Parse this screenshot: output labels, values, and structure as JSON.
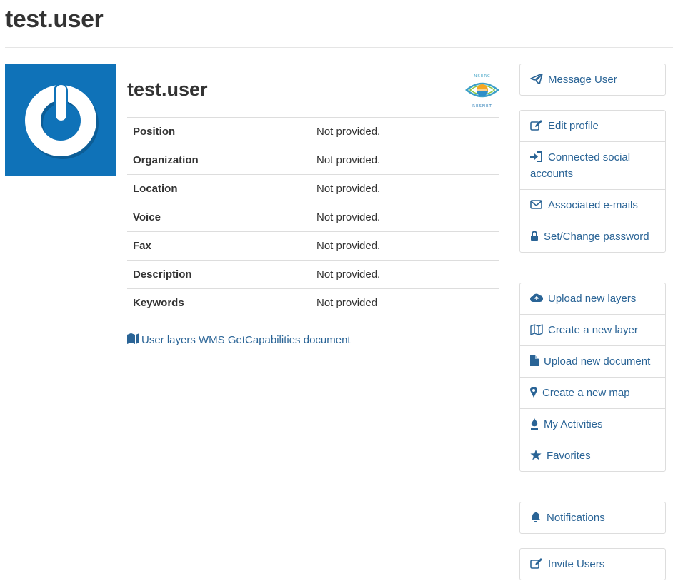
{
  "page": {
    "title": "test.user"
  },
  "profile": {
    "name": "test.user",
    "badge": {
      "top_text": "NSERC",
      "bottom_text": "RESNET"
    },
    "fields": [
      {
        "label": "Position",
        "value": "Not provided."
      },
      {
        "label": "Organization",
        "value": "Not provided."
      },
      {
        "label": "Location",
        "value": "Not provided."
      },
      {
        "label": "Voice",
        "value": "Not provided."
      },
      {
        "label": "Fax",
        "value": "Not provided."
      },
      {
        "label": "Description",
        "value": "Not provided."
      },
      {
        "label": "Keywords",
        "value": "Not provided"
      }
    ],
    "wms_link": {
      "label": "User layers WMS GetCapabilities document",
      "icon": "map-icon"
    }
  },
  "sidebar": {
    "message": {
      "label": "Message User",
      "icon": "paper-plane-icon"
    },
    "account": [
      {
        "label": "Edit profile",
        "icon": "edit-icon"
      },
      {
        "label": "Connected social accounts",
        "icon": "sign-in-icon"
      },
      {
        "label": "Associated e-mails",
        "icon": "envelope-icon"
      },
      {
        "label": "Set/Change password",
        "icon": "lock-icon"
      }
    ],
    "content": [
      {
        "label": "Upload new layers",
        "icon": "cloud-upload-icon"
      },
      {
        "label": "Create a new layer",
        "icon": "map-outline-icon"
      },
      {
        "label": "Upload new document",
        "icon": "file-icon"
      },
      {
        "label": "Create a new map",
        "icon": "map-marker-icon"
      },
      {
        "label": "My Activities",
        "icon": "fire-icon"
      },
      {
        "label": "Favorites",
        "icon": "star-icon"
      }
    ],
    "notifications": {
      "label": "Notifications",
      "icon": "bell-icon"
    },
    "invite": {
      "label": "Invite Users",
      "icon": "edit-icon"
    }
  },
  "colors": {
    "link": "#2a6496",
    "avatar_bg": "#0f72b8",
    "border": "#dddddd",
    "text": "#333333"
  }
}
